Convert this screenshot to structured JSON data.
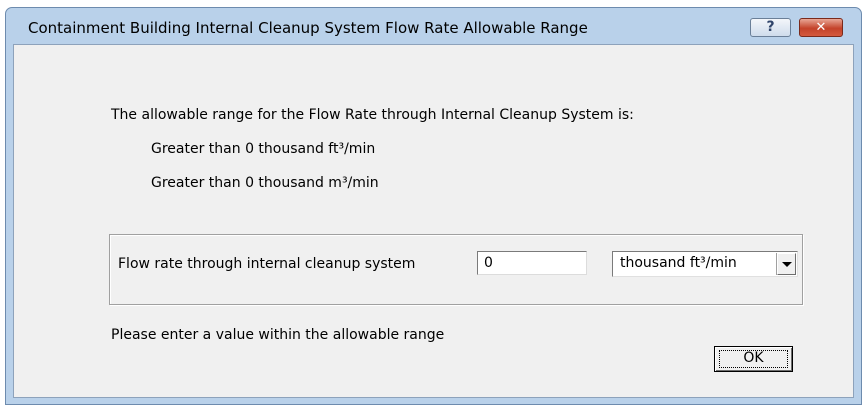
{
  "window": {
    "title": "Containment Building Internal Cleanup System Flow Rate Allowable Range",
    "help_label": "?",
    "close_label": "✕",
    "frame_color": "#b9d1ea",
    "close_color": "#c4432a"
  },
  "range_info": {
    "heading": "The allowable range for the Flow Rate through Internal Cleanup System is:",
    "line_imperial": "Greater than 0 thousand ft³/min",
    "line_metric": "Greater than 0 thousand m³/min"
  },
  "flow_input": {
    "label": "Flow rate through internal cleanup system",
    "value": "0",
    "unit_selected": "thousand ft³/min"
  },
  "footer": {
    "message": "Please enter a value within the allowable range",
    "ok_label": "OK"
  },
  "icons": {
    "help": "help-icon",
    "close": "close-icon",
    "dropdown": "chevron-down-icon"
  }
}
